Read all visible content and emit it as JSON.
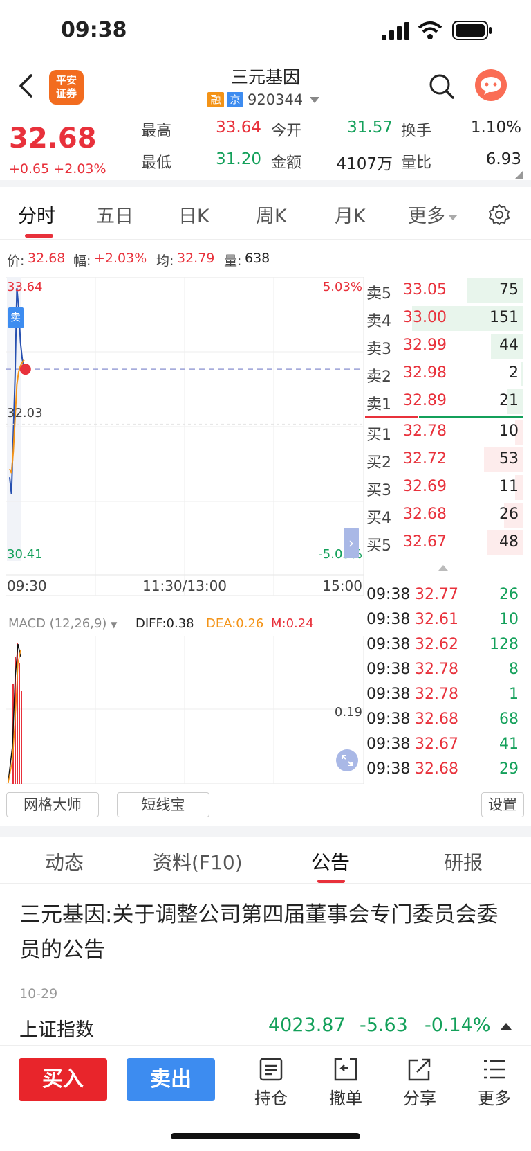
{
  "status": {
    "time": "09:38"
  },
  "header": {
    "logo_line1": "平安",
    "logo_line2": "证券",
    "title": "三元基因",
    "tag_rong": "融",
    "tag_jing": "京",
    "code": "920344"
  },
  "quote": {
    "price": "32.68",
    "change": "+0.65",
    "change_pct": "+2.03%",
    "high_label": "最高",
    "high": "33.64",
    "open_label": "今开",
    "open": "31.57",
    "turnover_label": "换手",
    "turnover": "1.10%",
    "low_label": "最低",
    "low": "31.20",
    "amount_label": "金额",
    "amount": "4107万",
    "ratio_label": "量比",
    "ratio": "6.93"
  },
  "tabs": [
    "分时",
    "五日",
    "日K",
    "周K",
    "月K",
    "更多"
  ],
  "info": {
    "price_label": "价:",
    "price": "32.68",
    "amp_label": "幅:",
    "amp": "+2.03%",
    "avg_label": "均:",
    "avg": "32.79",
    "vol_label": "量:",
    "vol": "638"
  },
  "chart": {
    "y_top": "33.64",
    "y_mid": "32.03",
    "y_bot": "30.41",
    "pct_top": "5.03%",
    "pct_bot": "-5.03%",
    "x_start": "09:30",
    "x_mid": "11:30/13:00",
    "x_end": "15:00",
    "sell_marker": "卖"
  },
  "chart_data": {
    "type": "line",
    "x": [
      "09:30",
      "09:31",
      "09:32",
      "09:33",
      "09:34",
      "09:35",
      "09:36",
      "09:37",
      "09:38"
    ],
    "series": [
      {
        "values": [
          31.4,
          31.2,
          31.9,
          32.6,
          33.64,
          33.4,
          33.0,
          32.8,
          32.68
        ]
      },
      {
        "values": [
          31.5,
          31.45,
          31.7,
          32.1,
          32.5,
          32.65,
          32.72,
          32.76,
          32.79
        ]
      }
    ],
    "ylim": [
      30.41,
      33.64
    ],
    "reference": 32.03
  },
  "macd": {
    "label": "MACD (12,26,9)",
    "diff": "DIFF:0.38",
    "dea": "DEA:0.26",
    "m": "M:0.24",
    "axis": "0.19"
  },
  "orderbook": [
    {
      "label": "卖5",
      "price": "33.05",
      "vol": "75",
      "side": "sell",
      "frac": 0.5
    },
    {
      "label": "卖4",
      "price": "33.00",
      "vol": "151",
      "side": "sell",
      "frac": 1.0
    },
    {
      "label": "卖3",
      "price": "32.99",
      "vol": "44",
      "side": "sell",
      "frac": 0.29
    },
    {
      "label": "卖2",
      "price": "32.98",
      "vol": "2",
      "side": "sell",
      "frac": 0.02
    },
    {
      "label": "卖1",
      "price": "32.89",
      "vol": "21",
      "side": "sell",
      "frac": 0.14
    },
    {
      "label": "买1",
      "price": "32.78",
      "vol": "10",
      "side": "buy",
      "frac": 0.07
    },
    {
      "label": "买2",
      "price": "32.72",
      "vol": "53",
      "side": "buy",
      "frac": 0.35
    },
    {
      "label": "买3",
      "price": "32.69",
      "vol": "11",
      "side": "buy",
      "frac": 0.07
    },
    {
      "label": "买4",
      "price": "32.68",
      "vol": "26",
      "side": "buy",
      "frac": 0.17
    },
    {
      "label": "买5",
      "price": "32.67",
      "vol": "48",
      "side": "buy",
      "frac": 0.32
    }
  ],
  "ticks": [
    {
      "time": "09:38",
      "price": "32.77",
      "vol": "26"
    },
    {
      "time": "09:38",
      "price": "32.61",
      "vol": "10"
    },
    {
      "time": "09:38",
      "price": "32.62",
      "vol": "128"
    },
    {
      "time": "09:38",
      "price": "32.78",
      "vol": "8"
    },
    {
      "time": "09:38",
      "price": "32.78",
      "vol": "1"
    },
    {
      "time": "09:38",
      "price": "32.68",
      "vol": "68"
    },
    {
      "time": "09:38",
      "price": "32.67",
      "vol": "41"
    },
    {
      "time": "09:38",
      "price": "32.68",
      "vol": "29"
    }
  ],
  "tools": {
    "grid": "网格大师",
    "short": "短线宝",
    "settings": "设置"
  },
  "news_tabs": [
    "动态",
    "资料(F10)",
    "公告",
    "研报"
  ],
  "news": {
    "title": "三元基因:关于调整公司第四届董事会专门委员会委员的公告",
    "date": "10-29"
  },
  "index": {
    "name": "上证指数",
    "value": "4023.87",
    "change": "-5.63",
    "pct": "-0.14%"
  },
  "bottom": {
    "buy": "买入",
    "sell": "卖出",
    "hold": "持仓",
    "cancel": "撤单",
    "share": "分享",
    "more": "更多"
  },
  "colors": {
    "red": "#e8313b",
    "green": "#13a05a",
    "blue": "#3d8cf0",
    "orange": "#f39317",
    "logo": "#f26c1f"
  }
}
